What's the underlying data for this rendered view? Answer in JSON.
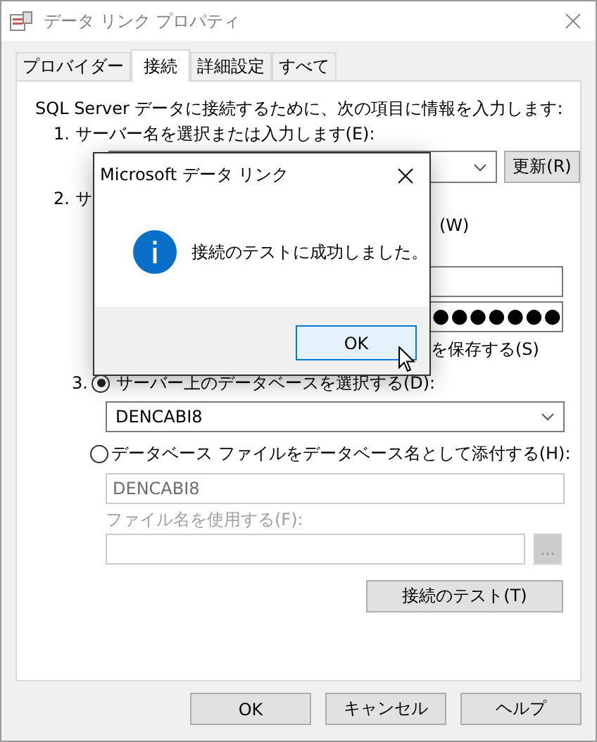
{
  "window": {
    "title": "データ リンク プロパティ"
  },
  "tabs": [
    {
      "label": "プロバイダー",
      "selected": false
    },
    {
      "label": "接続",
      "selected": true
    },
    {
      "label": "詳細設定",
      "selected": false
    },
    {
      "label": "すべて",
      "selected": false
    }
  ],
  "connection": {
    "intro": "SQL Server データに接続するために、次の項目に情報を入力します:",
    "step1": {
      "label": "1. サーバー名を選択または入力します(E):",
      "refresh_button": "更新(R)"
    },
    "step2": {
      "label": "2. サ",
      "option_suffix": "(W)",
      "password": "●●●●●●●",
      "save_password_suffix": "を保存する(S)"
    },
    "step3": {
      "number": "3.",
      "options": [
        {
          "kind": "combo",
          "label": "サーバー上のデータベースを選択する(D):",
          "selected": true,
          "value": "DENCABI8"
        },
        {
          "kind": "text",
          "label": "データベース ファイルをデータベース名として添付する(H):",
          "selected": false,
          "value": "DENCABI8"
        }
      ],
      "file_label": "ファイル名を使用する(F):",
      "browse_button": "..."
    },
    "test_button": "接続のテスト(T)"
  },
  "buttons": [
    "OK",
    "キャンセル",
    "ヘルプ"
  ],
  "message_box": {
    "title": "Microsoft データ リンク",
    "message": "接続のテストに成功しました。",
    "button": "OK",
    "focused": true
  }
}
